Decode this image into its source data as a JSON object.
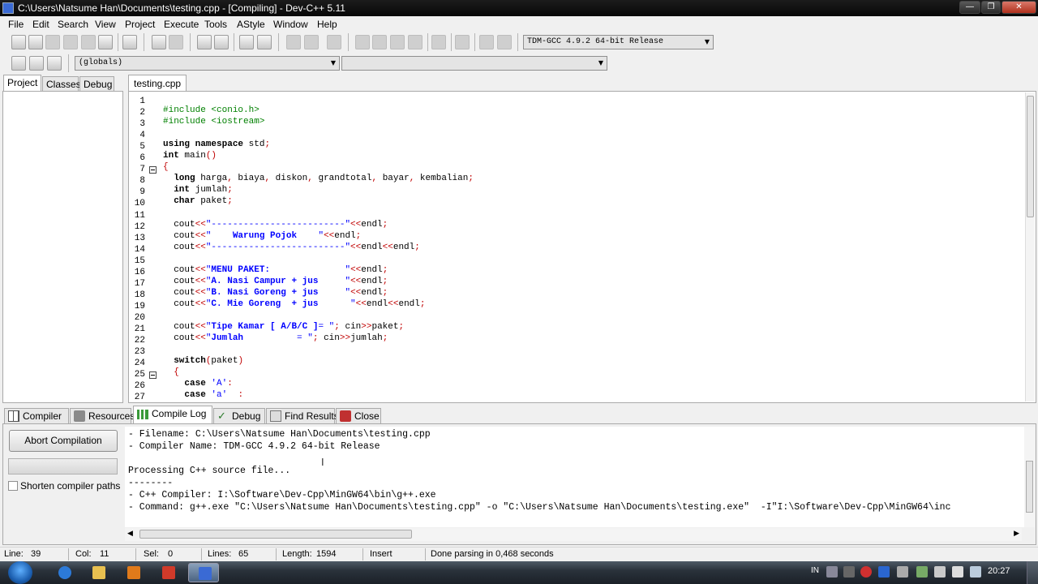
{
  "window": {
    "title": "C:\\Users\\Natsume Han\\Documents\\testing.cpp - [Compiling] - Dev-C++ 5.11"
  },
  "menu": [
    "File",
    "Edit",
    "Search",
    "View",
    "Project",
    "Execute",
    "Tools",
    "AStyle",
    "Window",
    "Help"
  ],
  "toolbar": {
    "compiler_select": "TDM-GCC 4.9.2 64-bit Release",
    "scope_select": "(globals)",
    "member_select": ""
  },
  "left_tabs": [
    "Project",
    "Classes",
    "Debug"
  ],
  "editor": {
    "file_tab": "testing.cpp",
    "lines": [
      {
        "n": "1",
        "html": ""
      },
      {
        "n": "2",
        "html": "<span class=\"pp\">#include &lt;conio.h&gt;</span>"
      },
      {
        "n": "3",
        "html": "<span class=\"pp\">#include &lt;iostream&gt;</span>"
      },
      {
        "n": "4",
        "html": ""
      },
      {
        "n": "5",
        "html": "<span class=\"kw\">using namespace</span> std<span class=\"op\">;</span>"
      },
      {
        "n": "6",
        "html": "<span class=\"kw\">int</span> main<span class=\"op\">()</span>"
      },
      {
        "n": "7",
        "html": "<span class=\"op\">{</span>"
      },
      {
        "n": "8",
        "html": "  <span class=\"kw\">long</span> harga<span class=\"op\">,</span> biaya<span class=\"op\">,</span> diskon<span class=\"op\">,</span> grandtotal<span class=\"op\">,</span> bayar<span class=\"op\">,</span> kembalian<span class=\"op\">;</span>"
      },
      {
        "n": "9",
        "html": "  <span class=\"kw\">int</span> jumlah<span class=\"op\">;</span>"
      },
      {
        "n": "10",
        "html": "  <span class=\"kw\">char</span> paket<span class=\"op\">;</span>"
      },
      {
        "n": "11",
        "html": ""
      },
      {
        "n": "12",
        "html": "  cout<span class=\"op\">&lt;&lt;</span><span class=\"str\">\"-------------------------\"</span><span class=\"op\">&lt;&lt;</span>endl<span class=\"op\">;</span>"
      },
      {
        "n": "13",
        "html": "  cout<span class=\"op\">&lt;&lt;</span><span class=\"str\">\"    <b>Warung Pojok</b>    \"</span><span class=\"op\">&lt;&lt;</span>endl<span class=\"op\">;</span>"
      },
      {
        "n": "14",
        "html": "  cout<span class=\"op\">&lt;&lt;</span><span class=\"str\">\"-------------------------\"</span><span class=\"op\">&lt;&lt;</span>endl<span class=\"op\">&lt;&lt;</span>endl<span class=\"op\">;</span>"
      },
      {
        "n": "15",
        "html": ""
      },
      {
        "n": "16",
        "html": "  cout<span class=\"op\">&lt;&lt;</span><span class=\"str\">\"<b>MENU PAKET:</b>              \"</span><span class=\"op\">&lt;&lt;</span>endl<span class=\"op\">;</span>"
      },
      {
        "n": "17",
        "html": "  cout<span class=\"op\">&lt;&lt;</span><span class=\"str\">\"<b>A. Nasi Campur + jus</b>     \"</span><span class=\"op\">&lt;&lt;</span>endl<span class=\"op\">;</span>"
      },
      {
        "n": "18",
        "html": "  cout<span class=\"op\">&lt;&lt;</span><span class=\"str\">\"<b>B. Nasi Goreng + jus</b>     \"</span><span class=\"op\">&lt;&lt;</span>endl<span class=\"op\">;</span>"
      },
      {
        "n": "19",
        "html": "  cout<span class=\"op\">&lt;&lt;</span><span class=\"str\">\"<b>C. Mie Goreng  + jus</b>      \"</span><span class=\"op\">&lt;&lt;</span>endl<span class=\"op\">&lt;&lt;</span>endl<span class=\"op\">;</span>"
      },
      {
        "n": "20",
        "html": ""
      },
      {
        "n": "21",
        "html": "  cout<span class=\"op\">&lt;&lt;</span><span class=\"str\">\"<b>Tipe Kamar [ A/B/C ]</b>= \"</span><span class=\"op\">;</span> cin<span class=\"op\">&gt;&gt;</span>paket<span class=\"op\">;</span>"
      },
      {
        "n": "22",
        "html": "  cout<span class=\"op\">&lt;&lt;</span><span class=\"str\">\"<b>Jumlah</b>          = \"</span><span class=\"op\">;</span> cin<span class=\"op\">&gt;&gt;</span>jumlah<span class=\"op\">;</span>"
      },
      {
        "n": "23",
        "html": ""
      },
      {
        "n": "24",
        "html": "  <span class=\"kw\">switch</span><span class=\"op\">(</span>paket<span class=\"op\">)</span>"
      },
      {
        "n": "25",
        "html": "  <span class=\"op\">{</span>"
      },
      {
        "n": "26",
        "html": "    <span class=\"kw\">case</span> <span class=\"str\">'A'</span><span class=\"op\">:</span>"
      },
      {
        "n": "27",
        "html": "    <span class=\"kw\">case</span> <span class=\"str\">'a'</span>  <span class=\"op\">:</span>"
      }
    ]
  },
  "bottom_tabs": [
    "Compiler",
    "Resources",
    "Compile Log",
    "Debug",
    "Find Results",
    "Close"
  ],
  "compile_panel": {
    "abort_label": "Abort Compilation",
    "shorten_label": "Shorten compiler paths",
    "log": [
      "- Filename: C:\\Users\\Natsume Han\\Documents\\testing.cpp",
      "- Compiler Name: TDM-GCC 4.9.2 64-bit Release",
      "",
      "Processing C++ source file...",
      "--------",
      "- C++ Compiler: I:\\Software\\Dev-Cpp\\MinGW64\\bin\\g++.exe",
      "- Command: g++.exe \"C:\\Users\\Natsume Han\\Documents\\testing.cpp\" -o \"C:\\Users\\Natsume Han\\Documents\\testing.exe\"  -I\"I:\\Software\\Dev-Cpp\\MinGW64\\inc"
    ]
  },
  "status": {
    "line_label": "Line:",
    "line_value": "39",
    "col_label": "Col:",
    "col_value": "11",
    "sel_label": "Sel:",
    "sel_value": "0",
    "lines_label": "Lines:",
    "lines_value": "65",
    "length_label": "Length:",
    "length_value": "1594",
    "mode": "Insert",
    "message": "Done parsing in 0,468 seconds"
  },
  "taskbar": {
    "lang": "IN",
    "clock": "20:27"
  }
}
